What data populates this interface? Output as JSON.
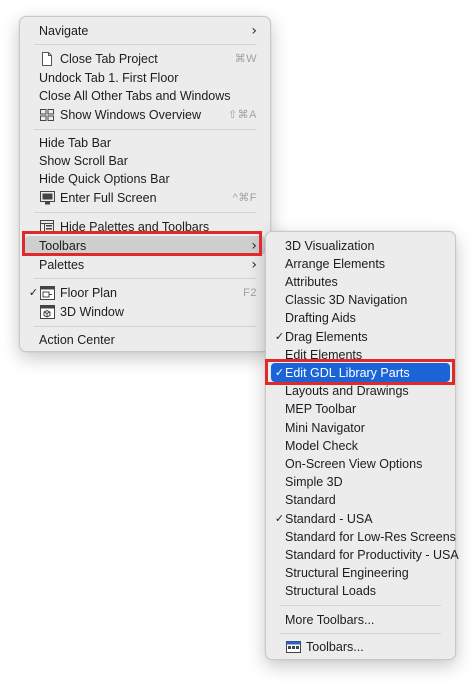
{
  "main_menu": {
    "navigate": "Navigate",
    "close_tab": {
      "label": "Close Tab Project",
      "shortcut": "⌘W"
    },
    "undock_tab": "Undock Tab 1. First Floor",
    "close_all_other": "Close All Other Tabs and Windows",
    "show_windows_overview": {
      "label": "Show Windows Overview",
      "shortcut": "⇧⌘A"
    },
    "hide_tab_bar": "Hide Tab Bar",
    "show_scroll_bar": "Show Scroll Bar",
    "hide_quick_options_bar": "Hide Quick Options Bar",
    "enter_full_screen": {
      "label": "Enter Full Screen",
      "shortcut": "^⌘F"
    },
    "hide_palettes_toolbars": "Hide Palettes and Toolbars",
    "toolbars": "Toolbars",
    "palettes": "Palettes",
    "floor_plan": {
      "label": "Floor Plan",
      "shortcut": "F2"
    },
    "window_3d": "3D Window",
    "action_center": "Action Center"
  },
  "submenu": {
    "items": [
      {
        "label": "3D Visualization"
      },
      {
        "label": "Arrange Elements"
      },
      {
        "label": "Attributes"
      },
      {
        "label": "Classic 3D Navigation"
      },
      {
        "label": "Drafting Aids"
      },
      {
        "label": "Drag Elements",
        "checked": true
      },
      {
        "label": "Edit Elements"
      },
      {
        "label": "Edit GDL Library Parts",
        "checked": true,
        "active": true
      },
      {
        "label": "Layouts and Drawings"
      },
      {
        "label": "MEP Toolbar"
      },
      {
        "label": "Mini Navigator"
      },
      {
        "label": "Model Check"
      },
      {
        "label": "On-Screen View Options"
      },
      {
        "label": "Simple 3D"
      },
      {
        "label": "Standard"
      },
      {
        "label": "Standard - USA",
        "checked": true
      },
      {
        "label": "Standard for Low-Res Screens"
      },
      {
        "label": "Standard for Productivity - USA"
      },
      {
        "label": "Structural Engineering"
      },
      {
        "label": "Structural Loads"
      }
    ],
    "more_toolbars": "More Toolbars...",
    "toolbars_dialog": "Toolbars..."
  },
  "symbols": {
    "checkmark": "✓",
    "chevron": "›"
  },
  "colors": {
    "selection": "#1a64d8",
    "annotation_border": "#e0292b",
    "menu_bg": "#ececec"
  }
}
